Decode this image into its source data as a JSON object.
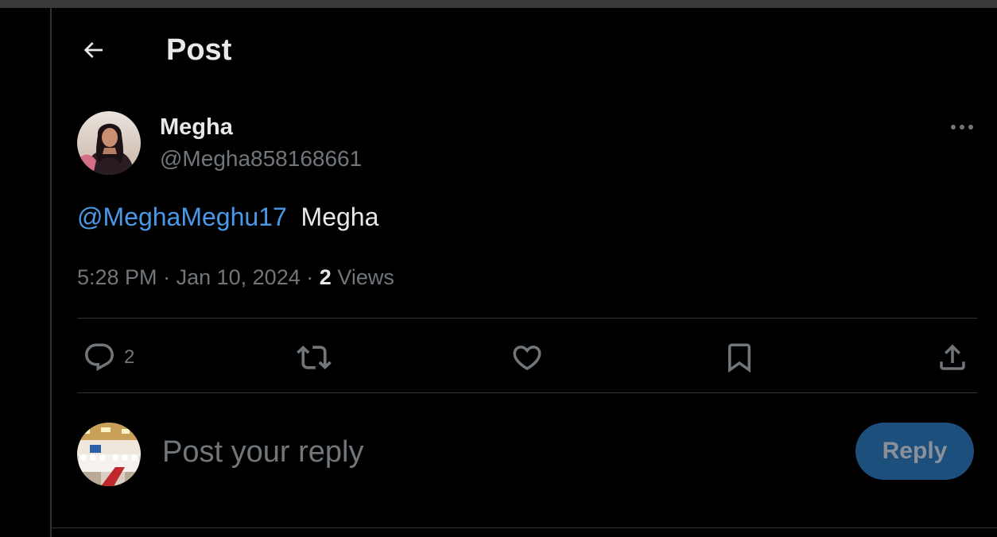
{
  "header": {
    "title": "Post",
    "back_icon": "arrow-left-icon"
  },
  "post": {
    "author": {
      "display_name": "Megha",
      "handle": "@Megha858168661"
    },
    "text": {
      "mention": "@MeghaMeghu17",
      "body": "Megha"
    },
    "time": "5:28 PM",
    "separator": "·",
    "date": "Jan 10, 2024",
    "views_count": "2",
    "views_label": "Views",
    "more_icon": "more-horizontal-icon",
    "actions": {
      "reply": {
        "icon": "reply-icon",
        "count": "2"
      },
      "repost": {
        "icon": "repost-icon"
      },
      "like": {
        "icon": "heart-icon"
      },
      "bookmark": {
        "icon": "bookmark-icon"
      },
      "share": {
        "icon": "share-icon"
      }
    }
  },
  "reply_box": {
    "placeholder": "Post your reply",
    "button_label": "Reply"
  },
  "colors": {
    "background": "#000000",
    "text": "#e7e9ea",
    "muted": "#71767b",
    "link": "#4a99e9",
    "divider": "#2f3336",
    "reply_button_bg": "#1d4f7d",
    "reply_button_text": "#8a9099"
  }
}
